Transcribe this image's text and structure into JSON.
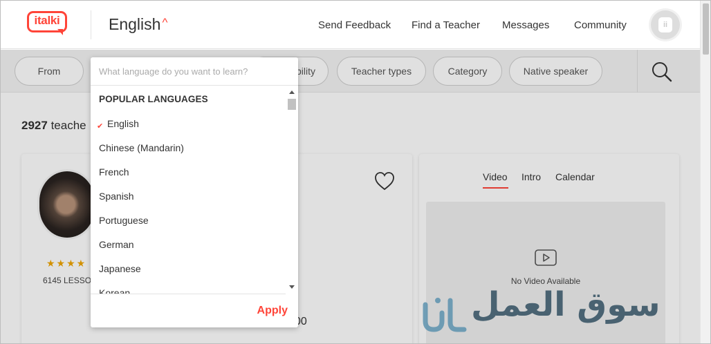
{
  "header": {
    "logo_text": "italki",
    "language": "English",
    "caret": "^",
    "nav": [
      {
        "label": "Send Feedback"
      },
      {
        "label": "Find a Teacher"
      },
      {
        "label": "Messages"
      },
      {
        "label": "Community"
      }
    ],
    "avatar_text": "ii"
  },
  "filters": {
    "pills": [
      {
        "label": "From"
      },
      {
        "label": "bility"
      },
      {
        "label": "Teacher types"
      },
      {
        "label": "Category"
      },
      {
        "label": "Native speaker"
      }
    ],
    "search_icon": "search-icon"
  },
  "results": {
    "count": "2927",
    "count_suffix": "teache"
  },
  "teacher_card": {
    "stars": "★★★★",
    "lessons": "6145 LESSO",
    "price_tail": "00",
    "favorite_icon": "heart-icon"
  },
  "media_card": {
    "tabs": [
      {
        "label": "Video"
      },
      {
        "label": "Intro"
      },
      {
        "label": "Calendar"
      }
    ],
    "active_tab": "Video",
    "no_video": "No Video Available",
    "play_icon": "play-icon"
  },
  "language_dropdown": {
    "placeholder": "What language do you want to learn?",
    "section_title": "POPULAR LANGUAGES",
    "selected": "English",
    "check_glyph": "✔",
    "items": [
      {
        "label": "English"
      },
      {
        "label": "Chinese (Mandarin)"
      },
      {
        "label": "French"
      },
      {
        "label": "Spanish"
      },
      {
        "label": "Portuguese"
      },
      {
        "label": "German"
      },
      {
        "label": "Japanese"
      },
      {
        "label": "Korean"
      }
    ],
    "apply_label": "Apply"
  },
  "watermark": {
    "text": "سوق العمل"
  },
  "colors": {
    "accent": "#ff4438",
    "star": "#f0a500",
    "watermark": "#2b4a5c"
  }
}
